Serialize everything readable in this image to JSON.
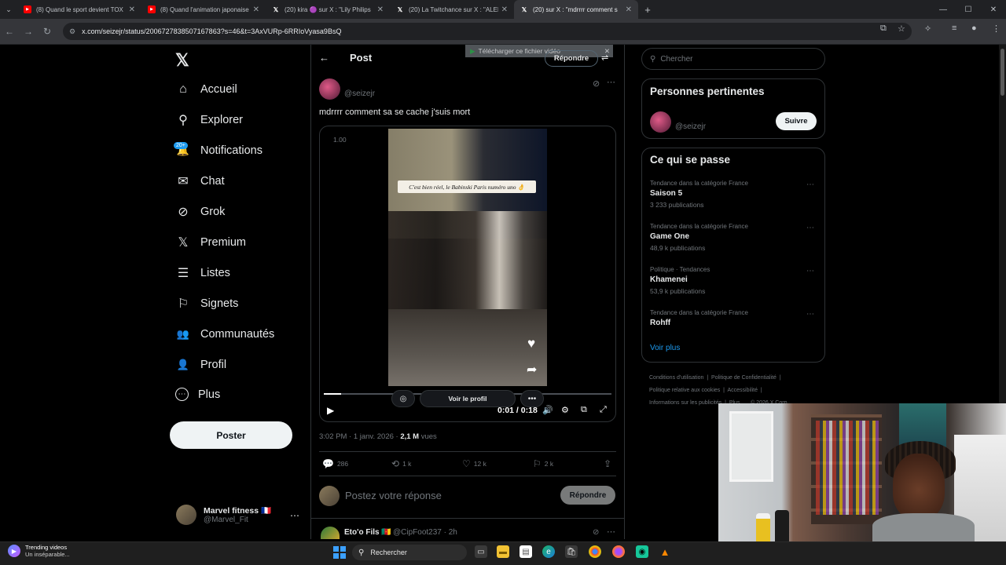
{
  "browser": {
    "tabs": [
      {
        "label": "(8) Quand le sport devient TOX",
        "icon": "youtube-icon"
      },
      {
        "label": "(8) Quand l'animation japonaise",
        "icon": "youtube-icon"
      },
      {
        "label": "(20) kira 🟣 sur X : \"Lily Philips",
        "icon": "x-icon"
      },
      {
        "label": "(20) La Twitchance sur X : \"ALEF",
        "icon": "x-icon"
      },
      {
        "label": "(20) sur X : \"mdrrrr comment s",
        "icon": "x-icon"
      }
    ],
    "new_tab": "+",
    "url": "x.com/seizejr/status/2006727838507167863?s=46&t=3AxVURp-6RRIoVyasa9BsQ"
  },
  "sidebar": {
    "logo": "𝕏",
    "items": [
      {
        "label": "Accueil",
        "icon": "home-icon",
        "glyph": "⌂"
      },
      {
        "label": "Explorer",
        "icon": "search-icon",
        "glyph": "⚲"
      },
      {
        "label": "Notifications",
        "icon": "bell-icon",
        "glyph": "🔔"
      },
      {
        "label": "Chat",
        "icon": "mail-icon",
        "glyph": "✉"
      },
      {
        "label": "Grok",
        "icon": "grok-icon",
        "glyph": "⊘"
      },
      {
        "label": "Premium",
        "icon": "x-premium-icon",
        "glyph": "𝕏"
      },
      {
        "label": "Listes",
        "icon": "list-icon",
        "glyph": "☰"
      },
      {
        "label": "Signets",
        "icon": "bookmark-icon",
        "glyph": "⚐"
      },
      {
        "label": "Communautés",
        "icon": "communities-icon",
        "glyph": "👥"
      },
      {
        "label": "Profil",
        "icon": "profile-icon",
        "glyph": "👤"
      },
      {
        "label": "Plus",
        "icon": "more-circle-icon",
        "glyph": "⋯"
      }
    ],
    "notif_badge": "20+",
    "post_button": "Poster",
    "account": {
      "name": "Marvel fitness 🇫🇷",
      "handle": "@Marvel_Fit"
    }
  },
  "post": {
    "header_title": "Post",
    "download_bar": "Télécharger ce fichier vidéo",
    "reply_top": "Répondre",
    "author_handle": "@seizejr",
    "text": "mdrrrr comment sa se cache j'suis mort",
    "video": {
      "speed": "1.00",
      "caption": "C'est bien réel, le Babinski Paris numéro uno 👌",
      "voir_profil": "Voir le profil",
      "time": "0:01 / 0:18",
      "progress": 0.06
    },
    "time": "3:02 PM · 1 janv. 2026 · ",
    "views_count": "2,1 M",
    "views_label": " vues",
    "stats": {
      "replies": "286",
      "reposts": "1 k",
      "likes": "12 k",
      "bookmarks": "2 k"
    },
    "reply_placeholder": "Postez votre réponse",
    "reply_button": "Répondre",
    "next": {
      "name": "Eto'o Fils 🇨🇲",
      "handle": "@CipFoot237 · 2h"
    }
  },
  "right": {
    "search_placeholder": "Chercher",
    "relevant_title": "Personnes pertinentes",
    "relevant_handle": "@seizejr",
    "follow": "Suivre",
    "trends_title": "Ce qui se passe",
    "trends": [
      {
        "context": "Tendance dans la catégorie France",
        "name": "Saison 5",
        "count": "3 233 publications"
      },
      {
        "context": "Tendance dans la catégorie France",
        "name": "Game One",
        "count": "48,9 k publications"
      },
      {
        "context": "Politique · Tendances",
        "name": "Khamenei",
        "count": "53,9 k publications"
      },
      {
        "context": "Tendance dans la catégorie France",
        "name": "Rohff",
        "count": ""
      }
    ],
    "see_more": "Voir plus",
    "footer": [
      "Conditions d'utilisation",
      "Politique de Confidentialité",
      "Politique relative aux cookies",
      "Accessibilité",
      "Informations sur les publicités",
      "Plus ...",
      "© 2026 X Corp."
    ]
  },
  "taskbar": {
    "widget_title": "Trending videos",
    "widget_sub": "Un inséparable...",
    "search": "Rechercher"
  }
}
